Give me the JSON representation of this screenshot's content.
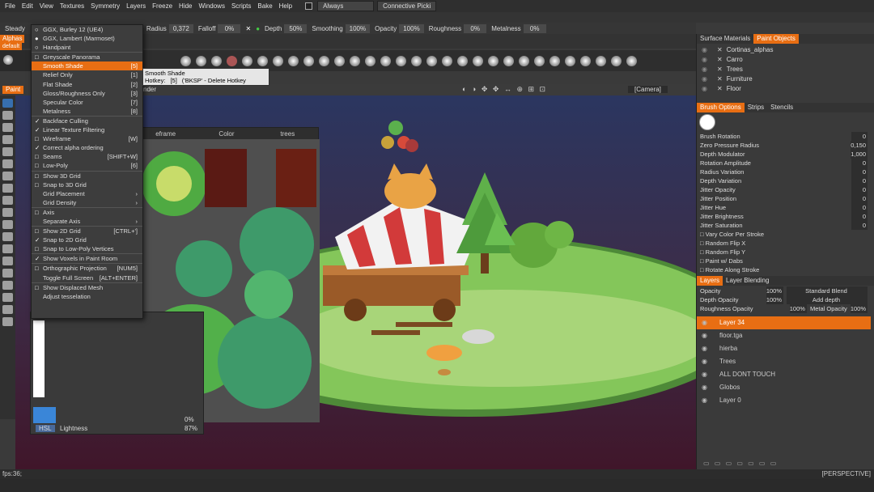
{
  "menubar": {
    "items": [
      "File",
      "Edit",
      "View",
      "Textures",
      "Symmetry",
      "Layers",
      "Freeze",
      "Hide",
      "Windows",
      "Scripts",
      "Bake",
      "Help"
    ],
    "always": "Always",
    "connective": "Connective Picki"
  },
  "toolbar": {
    "steady": "Steady",
    "radius_label": "Radius",
    "radius_value": "0,372",
    "falloff_label": "Falloff",
    "falloff_value": "0%",
    "depth_label": "Depth",
    "depth_value": "50%",
    "smoothing_label": "Smoothing",
    "smoothing_value": "100%",
    "opacity_label": "Opacity",
    "opacity_value": "100%",
    "roughness_label": "Roughness",
    "roughness_value": "0%",
    "metalness_label": "Metalness",
    "metalness_value": "0%"
  },
  "left": {
    "alphas_tab": "Alphas",
    "default_tab": "default",
    "paint_tab": "Paint"
  },
  "dropdown": {
    "items": [
      {
        "label": "GGX, Burley 12 (UE4)",
        "key": "",
        "mark": "radio"
      },
      {
        "label": "GGX, Lambert (Marmoset)",
        "key": "",
        "mark": "radio-on"
      },
      {
        "label": "Handpaint",
        "key": "",
        "mark": "radio"
      },
      {
        "sep": true
      },
      {
        "label": "Greyscale Panorama",
        "key": "",
        "mark": "box"
      },
      {
        "label": "Smooth Shade",
        "key": "[5]",
        "mark": "",
        "hl": true
      },
      {
        "label": "Relief Only",
        "key": "[1]",
        "mark": ""
      },
      {
        "label": "Flat Shade",
        "key": "[2]",
        "mark": ""
      },
      {
        "label": "Gloss/Roughness Only",
        "key": "[3]",
        "mark": ""
      },
      {
        "label": "Specular Color",
        "key": "[7]",
        "mark": ""
      },
      {
        "label": "Metalness",
        "key": "[8]",
        "mark": ""
      },
      {
        "sep": true
      },
      {
        "label": "Backface Culling",
        "key": "",
        "mark": "check"
      },
      {
        "label": "Linear Texture Filtering",
        "key": "",
        "mark": "check"
      },
      {
        "label": "Wireframe",
        "key": "[W]",
        "mark": "box"
      },
      {
        "label": "Correct alpha ordering",
        "key": "",
        "mark": "check"
      },
      {
        "label": "Seams",
        "key": "[SHIFT+W]",
        "mark": "box"
      },
      {
        "label": "Low-Poly",
        "key": "[6]",
        "mark": "box"
      },
      {
        "sep": true
      },
      {
        "label": "Show 3D Grid",
        "key": "",
        "mark": "box"
      },
      {
        "label": "Snap to 3D Grid",
        "key": "",
        "mark": "box"
      },
      {
        "label": "Grid Placement",
        "key": "›",
        "mark": ""
      },
      {
        "label": "Grid Density",
        "key": "›",
        "mark": ""
      },
      {
        "sep": true
      },
      {
        "label": "Axis",
        "key": "",
        "mark": "box"
      },
      {
        "label": "Separate Axis",
        "key": "›",
        "mark": ""
      },
      {
        "sep": true
      },
      {
        "label": "Show 2D Grid",
        "key": "[CTRL+']",
        "mark": "box"
      },
      {
        "label": "Snap to 2D Grid",
        "key": "",
        "mark": "check"
      },
      {
        "label": "Snap to Low-Poly Vertices",
        "key": "",
        "mark": "box"
      },
      {
        "sep": true
      },
      {
        "label": "Show Voxels in Paint Room",
        "key": "",
        "mark": "check"
      },
      {
        "sep": true
      },
      {
        "label": "Orthographic Projection",
        "key": "[NUM5]",
        "mark": "box"
      },
      {
        "label": "Toggle Full Screen",
        "key": "[ALT+ENTER]",
        "mark": ""
      },
      {
        "sep": true
      },
      {
        "label": "Show Displaced Mesh",
        "key": "",
        "mark": "box"
      },
      {
        "label": "Adjust tesselation",
        "key": "",
        "mark": ""
      }
    ]
  },
  "tooltip": {
    "title": "Smooth Shade",
    "hotkey_label": "Hotkey:",
    "hotkey": "[5]",
    "extra": "('BKSP' - Delete Hotkey"
  },
  "viewport": {
    "render_tab": "nder",
    "camera": "[Camera]",
    "perspective": "[PERSPECTIVE]"
  },
  "texwin": {
    "cols": [
      "eframe",
      "Color",
      "trees"
    ]
  },
  "colorpanel": {
    "hsl": "HSL",
    "lightness_label": "Lightness",
    "lightness_value": "87%",
    "saturation_value": "0%"
  },
  "status": {
    "fps": "fps:36;"
  },
  "right": {
    "tab_surface": "Surface Materials",
    "tab_paint": "Paint Objects",
    "objects": [
      "Cortinas_alphas",
      "Carro",
      "Trees",
      "Furniture",
      "Floor"
    ],
    "tab_brush": "Brush Options",
    "tab_strips": "Strips",
    "tab_stencils": "Stencils",
    "params": [
      {
        "label": "Brush Rotation",
        "value": "0"
      },
      {
        "label": "Zero Pressure Radius",
        "value": "0,150"
      },
      {
        "label": "Depth Modulator",
        "value": "1,000"
      },
      {
        "label": "Rotation Amplitude",
        "value": "0"
      },
      {
        "label": "Radius Variation",
        "value": "0"
      },
      {
        "label": "Depth Variation",
        "value": "0"
      },
      {
        "label": "Jitter Opacity",
        "value": "0"
      },
      {
        "label": "Jitter Position",
        "value": "0"
      },
      {
        "label": "Jitter Hue",
        "value": "0"
      },
      {
        "label": "Jitter Brightness",
        "value": "0"
      },
      {
        "label": "Jitter Saturation",
        "value": "0"
      }
    ],
    "checks": [
      "Vary Color Per Stroke",
      "Random Flip X",
      "Random Flip Y",
      "Paint w/ Dabs",
      "Rotate Along Stroke"
    ],
    "tab_layers": "Layers",
    "tab_blending": "Layer Blending",
    "layer_params": [
      {
        "label": "Opacity",
        "value": "100%",
        "right": "Standard Blend"
      },
      {
        "label": "Depth Opacity",
        "value": "100%",
        "right": "Add depth"
      },
      {
        "label": "Roughness Opacity",
        "value": "100%",
        "right": "Metal Opacity",
        "right_value": "100%"
      }
    ],
    "layers": [
      "Layer 34",
      "floor.tga",
      "hierba",
      "Trees",
      "ALL DONT TOUCH",
      "Globos",
      "Layer 0"
    ]
  }
}
